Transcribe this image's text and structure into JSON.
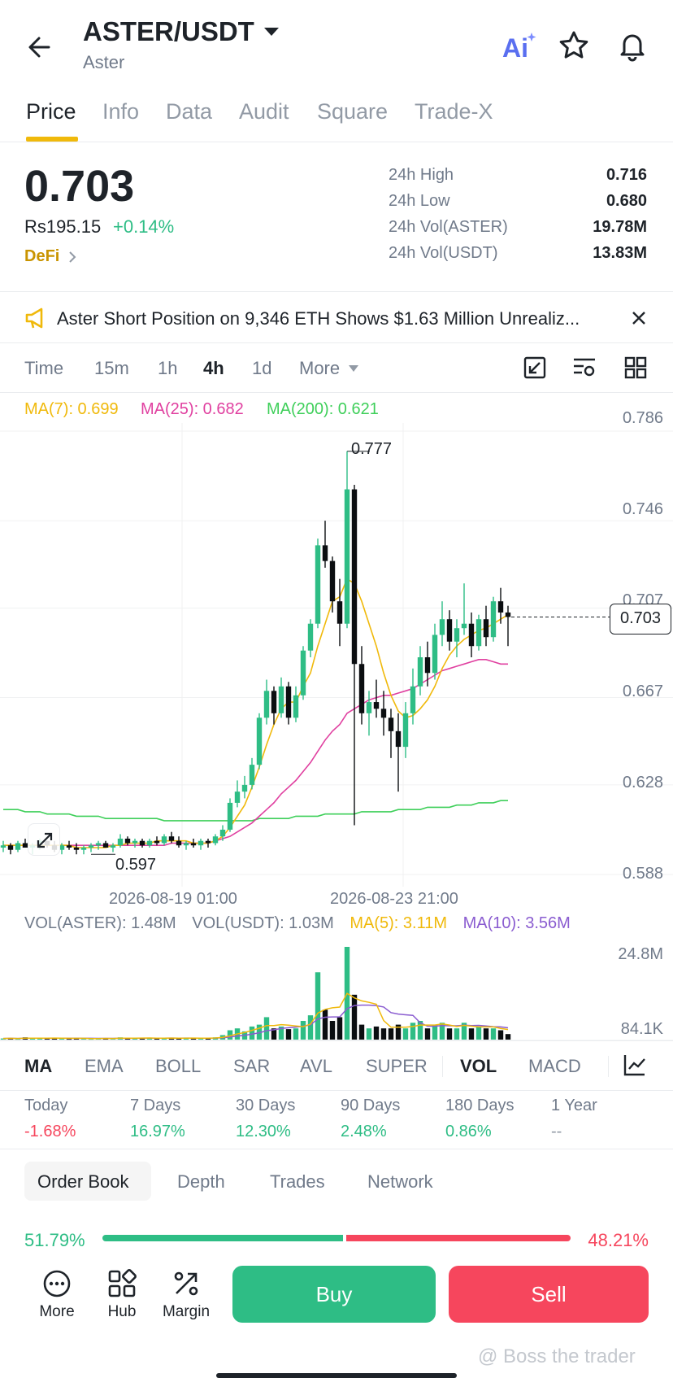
{
  "header": {
    "pair": "ASTER/USDT",
    "name": "Aster"
  },
  "tabs": [
    "Price",
    "Info",
    "Data",
    "Audit",
    "Square",
    "Trade-X"
  ],
  "price": {
    "last": "0.703",
    "local": "Rs195.15",
    "change": "+0.14%",
    "category": "DeFi"
  },
  "stats": [
    {
      "label": "24h High",
      "value": "0.716"
    },
    {
      "label": "24h Low",
      "value": "0.680"
    },
    {
      "label": "24h Vol(ASTER)",
      "value": "19.78M"
    },
    {
      "label": "24h Vol(USDT)",
      "value": "13.83M"
    }
  ],
  "news": {
    "text": "Aster Short Position on 9,346 ETH Shows $1.63 Million Unrealiz..."
  },
  "intervals": [
    "Time",
    "15m",
    "1h",
    "4h",
    "1d",
    "More"
  ],
  "chart": {
    "ma7": "MA(7): 0.699",
    "ma25": "MA(25): 0.682",
    "ma200": "MA(200): 0.621",
    "price_axis": [
      "0.786",
      "0.746",
      "0.707",
      "0.667",
      "0.628",
      "0.588"
    ],
    "time_axis": [
      "2026-08-19 01:00",
      "2026-08-23 21:00"
    ],
    "high_marker": "0.777",
    "low_marker": "0.597",
    "current_price": "0.703",
    "vol_aster": "VOL(ASTER): 1.48M",
    "vol_usdt": "VOL(USDT): 1.03M",
    "vol_ma5": "MA(5): 3.11M",
    "vol_ma10": "MA(10): 3.56M",
    "vol_axis": [
      "24.8M",
      "84.1K"
    ],
    "colors": {
      "up": "#2ebd85",
      "down": "#0b0e11",
      "ma7": "#f0b90b",
      "ma25": "#e040a0",
      "ma200": "#3fcf5a",
      "ma10": "#8a5cd0"
    }
  },
  "chart_data": {
    "type": "candlestick",
    "ylim": [
      0.588,
      0.786
    ],
    "candles": [
      [
        0.6,
        0.603,
        0.598,
        0.601
      ],
      [
        0.601,
        0.602,
        0.597,
        0.599
      ],
      [
        0.599,
        0.603,
        0.598,
        0.602
      ],
      [
        0.602,
        0.604,
        0.6,
        0.6
      ],
      [
        0.6,
        0.602,
        0.597,
        0.601
      ],
      [
        0.601,
        0.604,
        0.599,
        0.603
      ],
      [
        0.603,
        0.603,
        0.6,
        0.601
      ],
      [
        0.601,
        0.603,
        0.598,
        0.599
      ],
      [
        0.599,
        0.602,
        0.597,
        0.601
      ],
      [
        0.601,
        0.603,
        0.599,
        0.6
      ],
      [
        0.6,
        0.602,
        0.597,
        0.599
      ],
      [
        0.599,
        0.601,
        0.597,
        0.6
      ],
      [
        0.6,
        0.602,
        0.598,
        0.601
      ],
      [
        0.601,
        0.603,
        0.599,
        0.602
      ],
      [
        0.602,
        0.603,
        0.6,
        0.6
      ],
      [
        0.6,
        0.602,
        0.598,
        0.601
      ],
      [
        0.601,
        0.606,
        0.6,
        0.604
      ],
      [
        0.604,
        0.605,
        0.601,
        0.602
      ],
      [
        0.602,
        0.604,
        0.6,
        0.603
      ],
      [
        0.603,
        0.604,
        0.6,
        0.601
      ],
      [
        0.601,
        0.604,
        0.6,
        0.603
      ],
      [
        0.603,
        0.605,
        0.601,
        0.602
      ],
      [
        0.602,
        0.606,
        0.601,
        0.605
      ],
      [
        0.605,
        0.607,
        0.602,
        0.603
      ],
      [
        0.603,
        0.605,
        0.6,
        0.601
      ],
      [
        0.601,
        0.603,
        0.599,
        0.602
      ],
      [
        0.602,
        0.604,
        0.6,
        0.601
      ],
      [
        0.601,
        0.604,
        0.599,
        0.603
      ],
      [
        0.603,
        0.604,
        0.6,
        0.602
      ],
      [
        0.602,
        0.606,
        0.601,
        0.605
      ],
      [
        0.605,
        0.61,
        0.603,
        0.608
      ],
      [
        0.608,
        0.622,
        0.607,
        0.62
      ],
      [
        0.62,
        0.63,
        0.618,
        0.625
      ],
      [
        0.625,
        0.632,
        0.622,
        0.628
      ],
      [
        0.628,
        0.64,
        0.626,
        0.637
      ],
      [
        0.637,
        0.66,
        0.635,
        0.658
      ],
      [
        0.658,
        0.675,
        0.655,
        0.67
      ],
      [
        0.67,
        0.672,
        0.655,
        0.66
      ],
      [
        0.66,
        0.676,
        0.658,
        0.672
      ],
      [
        0.672,
        0.674,
        0.655,
        0.658
      ],
      [
        0.658,
        0.672,
        0.656,
        0.668
      ],
      [
        0.668,
        0.69,
        0.666,
        0.688
      ],
      [
        0.688,
        0.702,
        0.685,
        0.7
      ],
      [
        0.7,
        0.738,
        0.698,
        0.735
      ],
      [
        0.735,
        0.746,
        0.725,
        0.728
      ],
      [
        0.728,
        0.73,
        0.705,
        0.71
      ],
      [
        0.71,
        0.72,
        0.69,
        0.7
      ],
      [
        0.7,
        0.777,
        0.698,
        0.76
      ],
      [
        0.76,
        0.762,
        0.61,
        0.682
      ],
      [
        0.682,
        0.69,
        0.655,
        0.66
      ],
      [
        0.66,
        0.67,
        0.65,
        0.665
      ],
      [
        0.665,
        0.675,
        0.658,
        0.662
      ],
      [
        0.662,
        0.67,
        0.65,
        0.658
      ],
      [
        0.658,
        0.662,
        0.64,
        0.652
      ],
      [
        0.652,
        0.66,
        0.625,
        0.645
      ],
      [
        0.645,
        0.665,
        0.64,
        0.66
      ],
      [
        0.66,
        0.68,
        0.655,
        0.672
      ],
      [
        0.672,
        0.69,
        0.668,
        0.685
      ],
      [
        0.685,
        0.692,
        0.672,
        0.678
      ],
      [
        0.678,
        0.7,
        0.675,
        0.695
      ],
      [
        0.695,
        0.71,
        0.69,
        0.702
      ],
      [
        0.702,
        0.706,
        0.688,
        0.692
      ],
      [
        0.692,
        0.702,
        0.685,
        0.698
      ],
      [
        0.698,
        0.718,
        0.695,
        0.7
      ],
      [
        0.7,
        0.705,
        0.685,
        0.69
      ],
      [
        0.69,
        0.704,
        0.688,
        0.702
      ],
      [
        0.702,
        0.708,
        0.69,
        0.694
      ],
      [
        0.694,
        0.712,
        0.692,
        0.71
      ],
      [
        0.71,
        0.716,
        0.7,
        0.705
      ],
      [
        0.705,
        0.708,
        0.69,
        0.703
      ]
    ],
    "volumes": [
      0.3,
      0.4,
      0.2,
      0.6,
      0.3,
      0.4,
      0.3,
      0.5,
      0.3,
      0.2,
      0.4,
      0.3,
      0.2,
      0.3,
      0.4,
      0.3,
      0.6,
      0.4,
      0.3,
      0.5,
      0.4,
      0.3,
      0.5,
      0.4,
      0.3,
      0.4,
      0.5,
      0.4,
      0.3,
      0.6,
      1.2,
      2.5,
      3.0,
      2.2,
      3.5,
      4.0,
      6.0,
      3.0,
      3.5,
      2.8,
      3.0,
      5.0,
      6.5,
      18.0,
      8.0,
      5.0,
      6.0,
      24.8,
      12.0,
      4.0,
      3.0,
      3.5,
      3.0,
      3.0,
      4.0,
      3.0,
      4.5,
      5.0,
      3.0,
      4.0,
      4.5,
      3.0,
      3.0,
      4.5,
      3.0,
      3.5,
      3.0,
      3.0,
      2.5,
      1.48
    ],
    "ma7": [
      0.601,
      0.601,
      0.601,
      0.601,
      0.601,
      0.601,
      0.601,
      0.601,
      0.601,
      0.601,
      0.6,
      0.6,
      0.6,
      0.6,
      0.6,
      0.601,
      0.601,
      0.602,
      0.602,
      0.602,
      0.602,
      0.603,
      0.603,
      0.603,
      0.603,
      0.603,
      0.602,
      0.602,
      0.602,
      0.603,
      0.605,
      0.609,
      0.614,
      0.619,
      0.627,
      0.636,
      0.646,
      0.655,
      0.662,
      0.665,
      0.665,
      0.672,
      0.678,
      0.69,
      0.7,
      0.71,
      0.712,
      0.72,
      0.718,
      0.71,
      0.7,
      0.69,
      0.678,
      0.668,
      0.661,
      0.658,
      0.659,
      0.662,
      0.666,
      0.672,
      0.68,
      0.686,
      0.69,
      0.693,
      0.695,
      0.697,
      0.698,
      0.7,
      0.702,
      0.704
    ],
    "ma25": [
      0.601,
      0.601,
      0.601,
      0.601,
      0.601,
      0.601,
      0.601,
      0.601,
      0.601,
      0.601,
      0.601,
      0.601,
      0.601,
      0.601,
      0.601,
      0.601,
      0.601,
      0.601,
      0.601,
      0.601,
      0.601,
      0.601,
      0.601,
      0.602,
      0.602,
      0.602,
      0.602,
      0.602,
      0.602,
      0.603,
      0.604,
      0.605,
      0.607,
      0.609,
      0.611,
      0.614,
      0.617,
      0.62,
      0.624,
      0.627,
      0.63,
      0.634,
      0.638,
      0.643,
      0.648,
      0.652,
      0.655,
      0.66,
      0.662,
      0.664,
      0.666,
      0.667,
      0.668,
      0.668,
      0.669,
      0.67,
      0.671,
      0.673,
      0.675,
      0.677,
      0.679,
      0.68,
      0.681,
      0.682,
      0.683,
      0.684,
      0.684,
      0.683,
      0.682,
      0.682
    ],
    "ma200": [
      0.617,
      0.617,
      0.617,
      0.616,
      0.616,
      0.616,
      0.615,
      0.615,
      0.615,
      0.615,
      0.614,
      0.614,
      0.614,
      0.614,
      0.613,
      0.613,
      0.613,
      0.613,
      0.613,
      0.613,
      0.613,
      0.613,
      0.612,
      0.612,
      0.612,
      0.612,
      0.612,
      0.612,
      0.612,
      0.612,
      0.612,
      0.612,
      0.612,
      0.612,
      0.612,
      0.613,
      0.613,
      0.613,
      0.613,
      0.613,
      0.614,
      0.614,
      0.614,
      0.614,
      0.615,
      0.615,
      0.615,
      0.615,
      0.615,
      0.616,
      0.616,
      0.616,
      0.616,
      0.616,
      0.617,
      0.617,
      0.617,
      0.617,
      0.618,
      0.618,
      0.618,
      0.618,
      0.619,
      0.619,
      0.619,
      0.62,
      0.62,
      0.62,
      0.621,
      0.621
    ]
  },
  "indicators": [
    "MA",
    "EMA",
    "BOLL",
    "SAR",
    "AVL",
    "SUPER",
    "VOL",
    "MACD"
  ],
  "performance": [
    {
      "label": "Today",
      "value": "-1.68%",
      "dir": "down"
    },
    {
      "label": "7 Days",
      "value": "16.97%",
      "dir": "up"
    },
    {
      "label": "30 Days",
      "value": "12.30%",
      "dir": "up"
    },
    {
      "label": "90 Days",
      "value": "2.48%",
      "dir": "up"
    },
    {
      "label": "180 Days",
      "value": "0.86%",
      "dir": "up"
    },
    {
      "label": "1 Year",
      "value": "--",
      "dir": "none"
    }
  ],
  "orderbook_tabs": [
    "Order Book",
    "Depth",
    "Trades",
    "Network"
  ],
  "orderbook": {
    "buy_pct": "51.79%",
    "sell_pct": "48.21%",
    "buy_ratio": 0.5179
  },
  "bottom_nav": {
    "more": "More",
    "hub": "Hub",
    "margin": "Margin",
    "buy": "Buy",
    "sell": "Sell"
  },
  "watermark": "@ Boss the trader"
}
